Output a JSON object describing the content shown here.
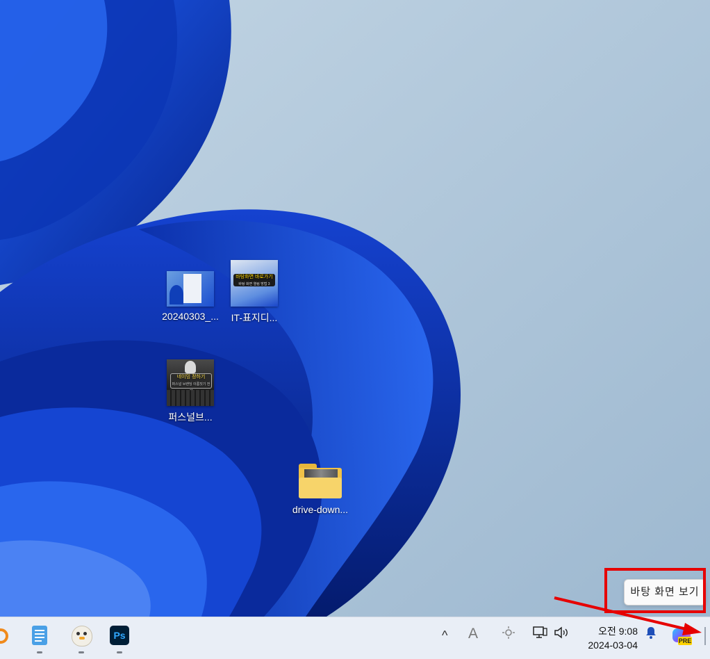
{
  "desktop": {
    "icons": [
      {
        "label": "20240303_..."
      },
      {
        "label": "IT-표지디...",
        "thumb_banner": "바탕화면 바로가기",
        "thumb_subtext": "바탕 화면 열림 방법 3"
      },
      {
        "label": "퍼스널브...",
        "thumb_banner": "네이밍 정하기",
        "thumb_subtext": "퍼스널 브랜딩 이름짓기 전략"
      },
      {
        "label": "drive-down..."
      }
    ]
  },
  "tooltip": {
    "text": "바탕 화면 보기"
  },
  "taskbar": {
    "apps": [
      {
        "name": "browser-app"
      },
      {
        "name": "notepad-app"
      },
      {
        "name": "mascot-app"
      },
      {
        "name": "photoshop-app",
        "text": "Ps"
      }
    ],
    "tray": {
      "chevron": "^",
      "ime": "A",
      "clock_time": "오전 9:08",
      "clock_date": "2024-03-04",
      "copilot_badge": "PRE"
    }
  },
  "colors": {
    "wallpaper_bg": "#aec4d9",
    "bloom_dark": "#0a2a9c",
    "bloom_light": "#2f6cf0",
    "highlight": "#e60000"
  }
}
